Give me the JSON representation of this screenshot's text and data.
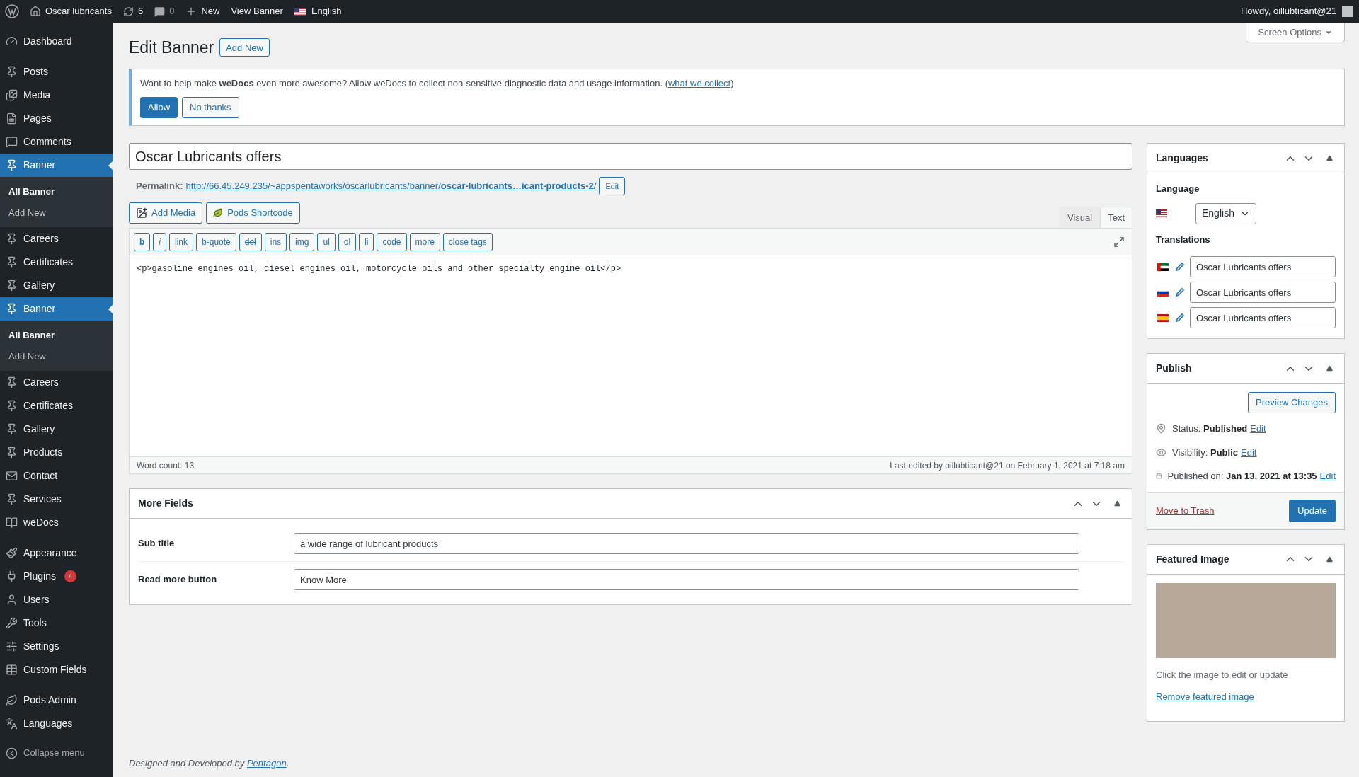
{
  "admin_bar": {
    "site": "Oscar lubricants",
    "updates": "6",
    "comments": "0",
    "new": "New",
    "view": "View Banner",
    "language": "English",
    "howdy": "Howdy, oillubticant@21"
  },
  "sidebar": {
    "groups": [
      [
        {
          "label": "Dashboard",
          "selected": false
        }
      ],
      [
        {
          "label": "Posts",
          "selected": false
        },
        {
          "label": "Media",
          "selected": false
        },
        {
          "label": "Pages",
          "selected": false
        },
        {
          "label": "Comments",
          "selected": false
        },
        {
          "label": "Banner",
          "selected": true,
          "children": [
            {
              "label": "All Banner",
              "selected": true
            },
            {
              "label": "Add New",
              "selected": false
            }
          ]
        },
        {
          "label": "Careers",
          "selected": false
        },
        {
          "label": "Certificates",
          "selected": false
        },
        {
          "label": "Gallery",
          "selected": false
        },
        {
          "label": "Banner",
          "selected": true,
          "children": [
            {
              "label": "All Banner",
              "selected": true
            },
            {
              "label": "Add New",
              "selected": false
            }
          ]
        },
        {
          "label": "Careers",
          "selected": false
        },
        {
          "label": "Certificates",
          "selected": false
        },
        {
          "label": "Gallery",
          "selected": false
        },
        {
          "label": "Products",
          "selected": false
        },
        {
          "label": "Contact",
          "selected": false
        },
        {
          "label": "Services",
          "selected": false
        },
        {
          "label": "weDocs",
          "selected": false
        }
      ],
      [
        {
          "label": "Appearance",
          "selected": false
        },
        {
          "label": "Plugins",
          "selected": false,
          "badge": "4"
        },
        {
          "label": "Users",
          "selected": false
        },
        {
          "label": "Tools",
          "selected": false
        },
        {
          "label": "Settings",
          "selected": false
        },
        {
          "label": "Custom Fields",
          "selected": false
        }
      ],
      [
        {
          "label": "Pods Admin",
          "selected": false
        },
        {
          "label": "Languages",
          "selected": false
        }
      ]
    ],
    "collapse": "Collapse menu"
  },
  "screen_options": "Screen Options",
  "page": {
    "title": "Edit Banner",
    "add_new": "Add New"
  },
  "notice": {
    "text": "Want to help make **weDocs** even more awesome? Allow weDocs to collect non-sensitive diagnostic data and usage information. (",
    "link": "what we collect",
    "after": ")",
    "buttons": [
      {
        "label": "Allow",
        "kind": "primary"
      },
      {
        "label": "No thanks",
        "kind": "secondary"
      }
    ]
  },
  "post_title": "Oscar Lubricants offers",
  "permalink": {
    "label": "Permalink:",
    "url": "http://66.45.249.235/~appspentaworks/oscarlubricants/banner/**oscar-lubricants…icant-products-2**/",
    "edit": "Edit"
  },
  "editor": {
    "media_buttons": [
      {
        "label": "Add Media",
        "kind": "media"
      },
      {
        "label": "Pods Shortcode",
        "kind": "pods"
      }
    ],
    "tabs": [
      {
        "label": "Visual",
        "selected": false
      },
      {
        "label": "Text",
        "selected": true
      }
    ],
    "quicktags": [
      {
        "label": "b",
        "kind": "bold"
      },
      {
        "label": "i",
        "kind": "italic"
      },
      {
        "label": "link",
        "kind": "link"
      },
      {
        "label": "b-quote",
        "kind": "tag"
      },
      {
        "label": "del",
        "kind": "strike"
      },
      {
        "label": "ins",
        "kind": "tag"
      },
      {
        "label": "img",
        "kind": "tag"
      },
      {
        "label": "ul",
        "kind": "tag"
      },
      {
        "label": "ol",
        "kind": "tag"
      },
      {
        "label": "li",
        "kind": "tag"
      },
      {
        "label": "code",
        "kind": "tag"
      },
      {
        "label": "more",
        "kind": "tag"
      },
      {
        "label": "close tags",
        "kind": "tag"
      }
    ],
    "content": "<p>gasoline engines oil, diesel engines oil, motorcycle oils and other specialty engine oil</p>",
    "word_count": "Word count: 13",
    "last_edited": "Last edited by oillubticant@21 on February 1, 2021 at 7:18 am"
  },
  "more_fields": {
    "title": "More Fields",
    "fields": [
      {
        "label": "Sub title",
        "value": "a wide range of lubricant products"
      },
      {
        "label": "Read more button",
        "value": "Know More"
      }
    ]
  },
  "languages_box": {
    "title": "Languages",
    "language_label": "Language",
    "language": "English",
    "translations_label": "Translations",
    "translations": [
      {
        "value": "Oscar Lubricants offers"
      },
      {
        "value": "Oscar Lubricants offers"
      },
      {
        "value": "Oscar Lubricants offers"
      }
    ]
  },
  "publish": {
    "title": "Publish",
    "preview": "Preview Changes",
    "rows": [
      {
        "kind": "status",
        "label": "Status:",
        "value": "Published",
        "edit": "Edit"
      },
      {
        "kind": "visibility",
        "label": "Visibility:",
        "value": "Public",
        "edit": "Edit"
      },
      {
        "kind": "date",
        "label": "Published on:",
        "value": "Jan 13, 2021 at 13:35",
        "edit": "Edit"
      }
    ],
    "trash": "Move to Trash",
    "update": "Update"
  },
  "featured_image": {
    "title": "Featured Image",
    "hint": "Click the image to edit or update",
    "remove": "Remove featured image"
  },
  "footer": {
    "text": "Designed and Developed by ",
    "link": "Pentagon",
    "after": "."
  }
}
